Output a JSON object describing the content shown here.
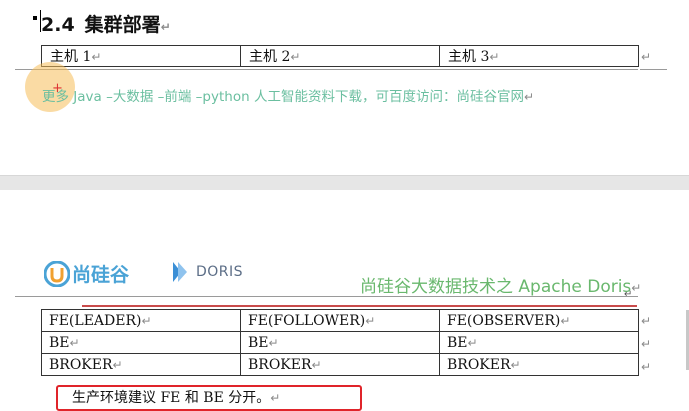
{
  "section": {
    "number": "2.4",
    "title": "集群部署"
  },
  "hosts_table": {
    "cells": [
      "主机 1",
      "主机 2",
      "主机 3"
    ]
  },
  "promo_line": "更多 Java –大数据 –前端 –python 人工智能资料下载，可百度访问：尚硅谷官网",
  "paragraph_mark": "↵",
  "header": {
    "logo_atguigu": "尚硅谷",
    "logo_doris": "DORIS",
    "subtitle": "尚硅谷大数据技术之 Apache Doris"
  },
  "roles_table": {
    "rows": [
      [
        "FE(LEADER)",
        "FE(FOLLOWER)",
        "FE(OBSERVER)"
      ],
      [
        "BE",
        "BE",
        "BE"
      ],
      [
        "BROKER",
        "BROKER",
        "BROKER"
      ]
    ]
  },
  "note": "生产环境建议 FE 和 BE 分开。",
  "colors": {
    "promo": "#6bbfa0",
    "subtitle": "#6ab86e",
    "highlight_box": "#e0242a",
    "logo_blue": "#4aa3d6"
  }
}
